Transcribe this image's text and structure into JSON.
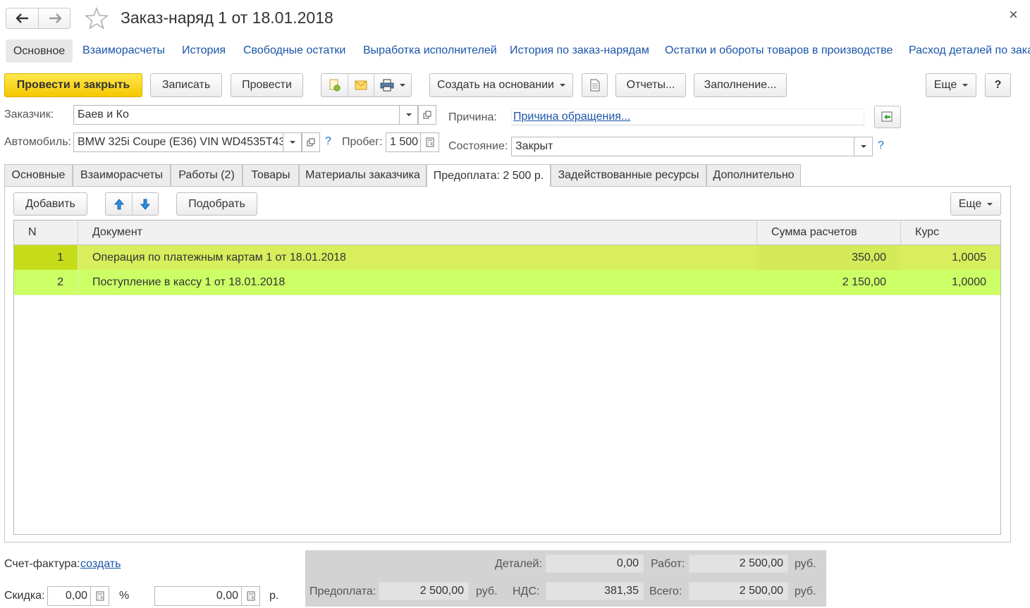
{
  "window": {
    "title": "Заказ-наряд 1 от 18.01.2018",
    "back_icon": "arrow-left-icon",
    "forward_icon": "arrow-right-icon",
    "star_icon": "star-icon",
    "close_symbol": "×"
  },
  "nav_links": [
    "Основное",
    "Взаиморасчеты",
    "История",
    "Свободные остатки",
    "Выработка исполнителей",
    "История по заказ-нарядам",
    "Остатки и обороты товаров в производстве",
    "Расход деталей по зака"
  ],
  "toolbar": {
    "post_close": "Провести и закрыть",
    "save": "Записать",
    "post": "Провести",
    "create_based": "Создать на основании",
    "reports": "Отчеты...",
    "fill": "Заполнение...",
    "more": "Еще",
    "help": "?"
  },
  "form": {
    "customer_label": "Заказчик:",
    "customer_value": "Баев и Ко",
    "car_label": "Автомобиль:",
    "car_value": "BMW 325i Coupe (E36) VIN WD4535T43",
    "mileage_label": "Пробег:",
    "mileage_value": "1 500",
    "reason_label": "Причина:",
    "reason_value": "Причина обращения...",
    "state_label": "Состояние:",
    "state_value": "Закрыт",
    "help": "?"
  },
  "tabs": [
    "Основные",
    "Взаиморасчеты",
    "Работы (2)",
    "Товары",
    "Материалы заказчика",
    "Предоплата: 2 500 р.",
    "Задействованные ресурсы",
    "Дополнительно"
  ],
  "active_tab": "Предоплата: 2 500 р.",
  "table_toolbar": {
    "add": "Добавить",
    "pick": "Подобрать",
    "more": "Еще"
  },
  "table": {
    "columns": [
      "N",
      "Документ",
      "Сумма расчетов",
      "Курс"
    ],
    "rows": [
      {
        "n": "1",
        "document": "Операция по платежным картам 1 от 18.01.2018",
        "sum": "350,00",
        "rate": "1,0005"
      },
      {
        "n": "2",
        "document": "Поступление в кассу 1 от 18.01.2018",
        "sum": "2 150,00",
        "rate": "1,0000"
      }
    ]
  },
  "footer": {
    "invoice_label": "Счет-фактура:",
    "invoice_link": "создать",
    "discount_label": "Скидка:",
    "discount_value": "0,00",
    "percent": "%",
    "discount_amount": "0,00",
    "rub_short": "р.",
    "details_label": "Деталей:",
    "details_value": "0,00",
    "works_label": "Работ:",
    "works_value": "2 500,00",
    "prepay_label": "Предоплата:",
    "prepay_value": "2 500,00",
    "vat_label": "НДС:",
    "vat_value": "381,35",
    "total_label": "Всего:",
    "total_value": "2 500,00",
    "currency": "руб."
  },
  "colors": {
    "row_selected": "#d8ee5c",
    "row_normal": "#ccff66",
    "row_selected_key": "#c6dc1a",
    "link": "#1a55a8",
    "primary_button": "#f5c800"
  }
}
